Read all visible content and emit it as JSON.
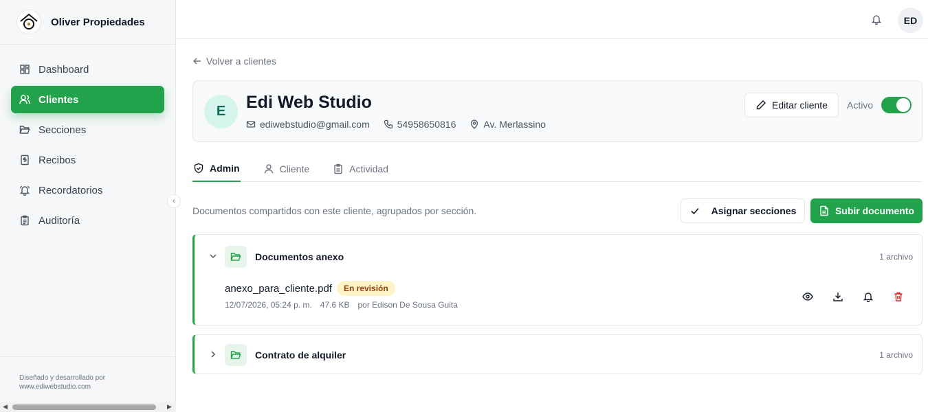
{
  "brand": {
    "name": "Oliver Propiedades"
  },
  "sidebar": {
    "items": [
      {
        "label": "Dashboard"
      },
      {
        "label": "Clientes"
      },
      {
        "label": "Secciones"
      },
      {
        "label": "Recibos"
      },
      {
        "label": "Recordatorios"
      },
      {
        "label": "Auditoría"
      }
    ],
    "footer_line1": "Diseñado y desarrollado por",
    "footer_line2": "www.ediwebstudio.com"
  },
  "topbar": {
    "avatar_initials": "ED"
  },
  "main": {
    "back_label": "Volver a clientes",
    "client": {
      "initial": "E",
      "name": "Edi Web Studio",
      "email": "ediwebstudio@gmail.com",
      "phone": "54958650816",
      "address": "Av. Merlassino",
      "edit_label": "Editar cliente",
      "status_label": "Activo",
      "active": true
    },
    "tabs": [
      {
        "label": "Admin"
      },
      {
        "label": "Cliente"
      },
      {
        "label": "Actividad"
      }
    ],
    "docs": {
      "description": "Documentos compartidos con este cliente, agrupados por sección.",
      "assign_label": "Asignar secciones",
      "upload_label": "Subir documento"
    },
    "sections": [
      {
        "title": "Documentos anexo",
        "count": "1 archivo",
        "files": [
          {
            "name": "anexo_para_cliente.pdf",
            "status": "En revisión",
            "date": "12/07/2026, 05:24 p. m.",
            "size": "47.6 KB",
            "author": "por Edison De Sousa Guita"
          }
        ]
      },
      {
        "title": "Contrato de alquiler",
        "count": "1 archivo",
        "files": []
      }
    ]
  },
  "colors": {
    "accent": "#22a34b",
    "danger": "#dc2626",
    "badge_bg": "#fef3c7"
  },
  "icons": [
    "bell-icon",
    "pencil-icon",
    "mail-icon",
    "phone-icon",
    "map-pin-icon",
    "shield-icon",
    "user-icon",
    "clipboard-icon",
    "check-icon",
    "file-icon",
    "folder-icon",
    "eye-icon",
    "download-icon",
    "trash-icon"
  ]
}
